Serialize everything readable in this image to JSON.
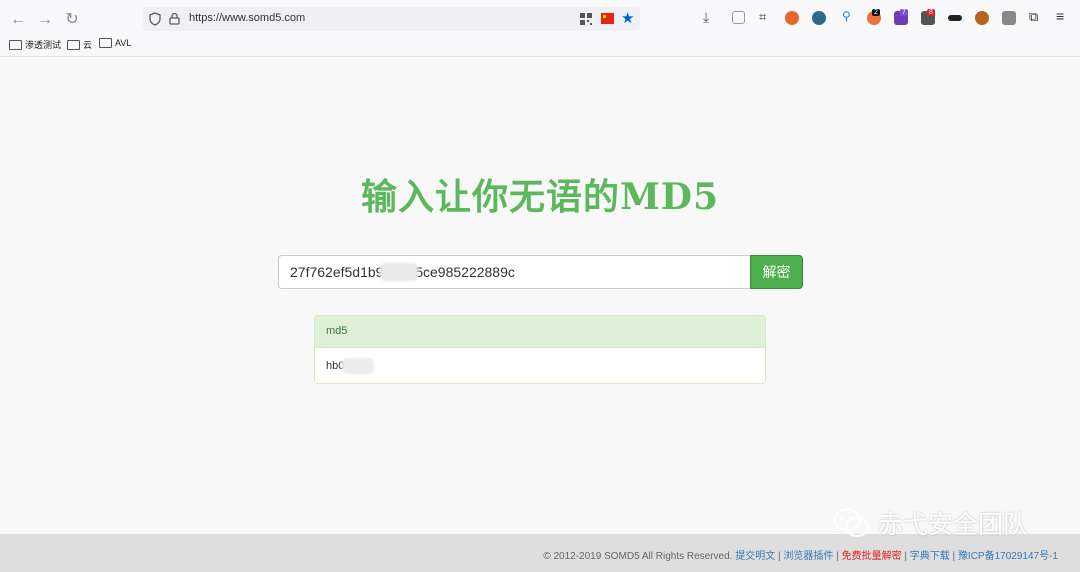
{
  "browser": {
    "url": "https://www.somd5.com",
    "bookmarks": [
      "渗透测试",
      "云",
      "AVL"
    ],
    "extension_badges": [
      "2",
      "7",
      "8"
    ]
  },
  "page": {
    "title": "输入让你无语的MD5",
    "search": {
      "value_start": "27f762ef5d1b9",
      "value_end": "d5ce985222889c",
      "button_label": "解密"
    },
    "result": {
      "type_label": "md5",
      "value_start": "hb0",
      "value_end": "06"
    }
  },
  "footer": {
    "copyright": "© 2012-2019 SOMD5 All Rights Reserved.",
    "links": [
      "提交明文",
      "浏览器插件",
      "免费批量解密",
      "字典下载",
      "豫ICP备17029147号-1"
    ],
    "separator": "|"
  },
  "watermark": {
    "text": "赤弋安全团队"
  },
  "colors": {
    "title": "#5cb85c",
    "button": "#4cae4c",
    "panel_head": "#dff0d8",
    "link": "#337ab7",
    "highlight_link": "#e02020"
  }
}
